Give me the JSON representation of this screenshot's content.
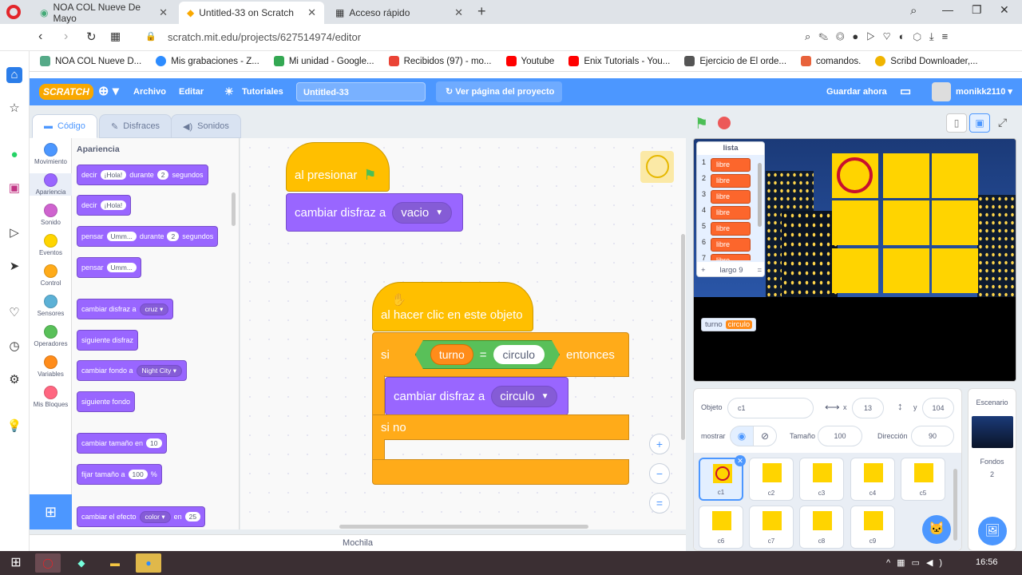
{
  "browser": {
    "tabs": [
      {
        "label": "NOA COL Nueve De Mayo"
      },
      {
        "label": "Untitled-33 on Scratch"
      },
      {
        "label": "Acceso rápido"
      }
    ],
    "url": "scratch.mit.edu/projects/627514974/editor",
    "bookmarks": [
      {
        "label": "NOA COL Nueve D..."
      },
      {
        "label": "Mis grabaciones - Z..."
      },
      {
        "label": "Mi unidad - Google..."
      },
      {
        "label": "Recibidos (97) - mo..."
      },
      {
        "label": "Youtube"
      },
      {
        "label": "Enix Tutorials - You..."
      },
      {
        "label": "Ejercicio de El orde..."
      },
      {
        "label": "comandos."
      },
      {
        "label": "Scribd Downloader,..."
      }
    ]
  },
  "menubar": {
    "logo": "SCRATCH",
    "archivo": "Archivo",
    "editar": "Editar",
    "tutoriales": "Tutoriales",
    "project_title": "Untitled-33",
    "ver_pagina": "Ver página del proyecto",
    "guardar": "Guardar ahora",
    "user": "monikk2110"
  },
  "tabs": {
    "codigo": "Código",
    "disfraces": "Disfraces",
    "sonidos": "Sonidos"
  },
  "categories": [
    {
      "label": "Movimiento",
      "color": "#4c97ff"
    },
    {
      "label": "Apariencia",
      "color": "#9966ff"
    },
    {
      "label": "Sonido",
      "color": "#cf63cf"
    },
    {
      "label": "Eventos",
      "color": "#ffd500"
    },
    {
      "label": "Control",
      "color": "#ffab19"
    },
    {
      "label": "Sensores",
      "color": "#5cb1d6"
    },
    {
      "label": "Operadores",
      "color": "#59c059"
    },
    {
      "label": "Variables",
      "color": "#ff8c1a"
    },
    {
      "label": "Mis Bloques",
      "color": "#ff6680"
    }
  ],
  "palette": {
    "heading": "Apariencia",
    "b1": {
      "a": "decir",
      "in1": "¡Hola!",
      "b": "durante",
      "in2": "2",
      "c": "segundos"
    },
    "b2": {
      "a": "decir",
      "in1": "¡Hola!"
    },
    "b3": {
      "a": "pensar",
      "in1": "Umm...",
      "b": "durante",
      "in2": "2",
      "c": "segundos"
    },
    "b4": {
      "a": "pensar",
      "in1": "Umm..."
    },
    "b5": {
      "a": "cambiar disfraz a",
      "dd": "cruz"
    },
    "b6": {
      "a": "siguiente disfraz"
    },
    "b7": {
      "a": "cambiar fondo a",
      "dd": "Night City"
    },
    "b8": {
      "a": "siguiente fondo"
    },
    "b9": {
      "a": "cambiar tamaño en",
      "in1": "10"
    },
    "b10": {
      "a": "fijar tamaño a",
      "in1": "100",
      "b": "%"
    },
    "b11": {
      "a": "cambiar el efecto",
      "dd": "color",
      "b": "en",
      "in1": "25"
    }
  },
  "script1": {
    "hat": "al presionar",
    "block": "cambiar disfraz a",
    "dd": "vacio"
  },
  "script2": {
    "hat": "al hacer clic en este objeto",
    "if": "si",
    "var": "turno",
    "eq": "=",
    "val": "circulo",
    "then": "entonces",
    "block": "cambiar disfraz a",
    "dd": "circulo",
    "else": "si no"
  },
  "zoom": {
    "in": "+",
    "out": "−",
    "reset": "="
  },
  "mochila": "Mochila",
  "stage": {
    "list_title": "lista",
    "list_items": [
      {
        "n": "1",
        "v": "libre"
      },
      {
        "n": "2",
        "v": "libre"
      },
      {
        "n": "3",
        "v": "libre"
      },
      {
        "n": "4",
        "v": "libre"
      },
      {
        "n": "5",
        "v": "libre"
      },
      {
        "n": "6",
        "v": "libre"
      },
      {
        "n": "7",
        "v": "libre"
      }
    ],
    "list_plus": "+",
    "list_len": "largo 9",
    "list_eq": "=",
    "var_name": "turno",
    "var_value": "circulo"
  },
  "sprite": {
    "objeto_label": "Objeto",
    "name": "c1",
    "x_label": "x",
    "x": "13",
    "y_label": "y",
    "y": "104",
    "mostrar": "mostrar",
    "tamano_label": "Tamaño",
    "tamano": "100",
    "direccion_label": "Dirección",
    "direccion": "90",
    "sprites": [
      {
        "name": "c1"
      },
      {
        "name": "c2"
      },
      {
        "name": "c3"
      },
      {
        "name": "c4"
      },
      {
        "name": "c5"
      },
      {
        "name": "c6"
      },
      {
        "name": "c7"
      },
      {
        "name": "c8"
      },
      {
        "name": "c9"
      }
    ]
  },
  "backdrop": {
    "title": "Escenario",
    "fondos_label": "Fondos",
    "fondos": "2"
  },
  "taskbar": {
    "time": "16:56"
  }
}
